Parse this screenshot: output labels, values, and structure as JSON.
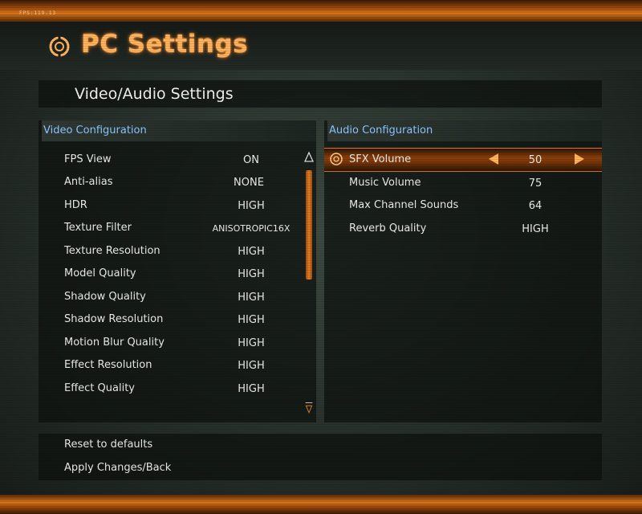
{
  "fps_counter": "FPS:119.13",
  "header": {
    "title": "PC Settings"
  },
  "section": {
    "title": "Video/Audio Settings"
  },
  "video": {
    "heading": "Video Configuration",
    "rows": [
      {
        "label": "FPS View",
        "value": "ON"
      },
      {
        "label": "Anti-alias",
        "value": "NONE"
      },
      {
        "label": "HDR",
        "value": "HIGH"
      },
      {
        "label": "Texture Filter",
        "value": "ANISOTROPIC16X"
      },
      {
        "label": "Texture Resolution",
        "value": "HIGH"
      },
      {
        "label": "Model Quality",
        "value": "HIGH"
      },
      {
        "label": "Shadow Quality",
        "value": "HIGH"
      },
      {
        "label": "Shadow Resolution",
        "value": "HIGH"
      },
      {
        "label": "Motion Blur Quality",
        "value": "HIGH"
      },
      {
        "label": "Effect Resolution",
        "value": "HIGH"
      },
      {
        "label": "Effect Quality",
        "value": "HIGH"
      }
    ]
  },
  "audio": {
    "heading": "Audio Configuration",
    "rows": [
      {
        "label": "SFX Volume",
        "value": "50"
      },
      {
        "label": "Music Volume",
        "value": "75"
      },
      {
        "label": "Max Channel Sounds",
        "value": "64"
      },
      {
        "label": "Reverb Quality",
        "value": "HIGH"
      }
    ]
  },
  "footer": {
    "reset": "Reset to defaults",
    "apply": "Apply Changes/Back"
  },
  "colors": {
    "accent": "#e07a1f",
    "heading_blue": "#8ec7ff",
    "title_orange": "#ffb35e"
  },
  "icons": [
    "logo-ring-icon",
    "selected-item-icon",
    "arrow-left-icon",
    "arrow-right-icon",
    "scroll-up-icon",
    "scroll-down-icon"
  ]
}
